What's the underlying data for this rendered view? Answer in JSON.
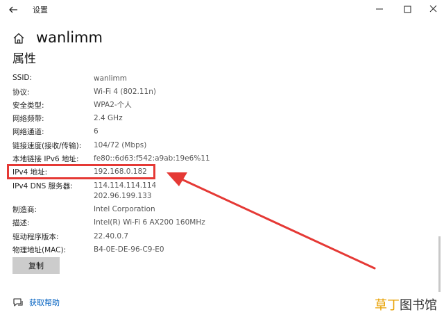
{
  "window": {
    "title": "设置"
  },
  "header": {
    "network_name": "wanlimm"
  },
  "section_title": "属性",
  "properties": [
    {
      "label": "SSID:",
      "value": "wanlimm"
    },
    {
      "label": "协议:",
      "value": "Wi-Fi 4 (802.11n)"
    },
    {
      "label": "安全类型:",
      "value": "WPA2-个人"
    },
    {
      "label": "网络频带:",
      "value": "2.4 GHz"
    },
    {
      "label": "网络通道:",
      "value": "6"
    },
    {
      "label": "链接速度(接收/传输):",
      "value": "104/72 (Mbps)"
    },
    {
      "label": "本地链接 IPv6 地址:",
      "value": "fe80::6d63:f542:a9ab:19e6%11"
    },
    {
      "label": "IPv4 地址:",
      "value": "192.168.0.182"
    },
    {
      "label": "IPv4 DNS 服务器:",
      "value": "114.114.114.114",
      "value2": "202.96.199.133"
    },
    {
      "label": "制造商:",
      "value": "Intel Corporation"
    },
    {
      "label": "描述:",
      "value": "Intel(R) Wi-Fi 6 AX200 160MHz"
    },
    {
      "label": "驱动程序版本:",
      "value": "22.40.0.7"
    },
    {
      "label": "物理地址(MAC):",
      "value": "B4-0E-DE-96-C9-E0"
    }
  ],
  "copy_button": "复制",
  "help_link": "获取帮助",
  "watermark": {
    "part_a": "草丁",
    "part_b": "图书馆"
  },
  "colors": {
    "highlight": "#e53935",
    "link": "#0060c0",
    "button_bg": "#cccccc"
  }
}
